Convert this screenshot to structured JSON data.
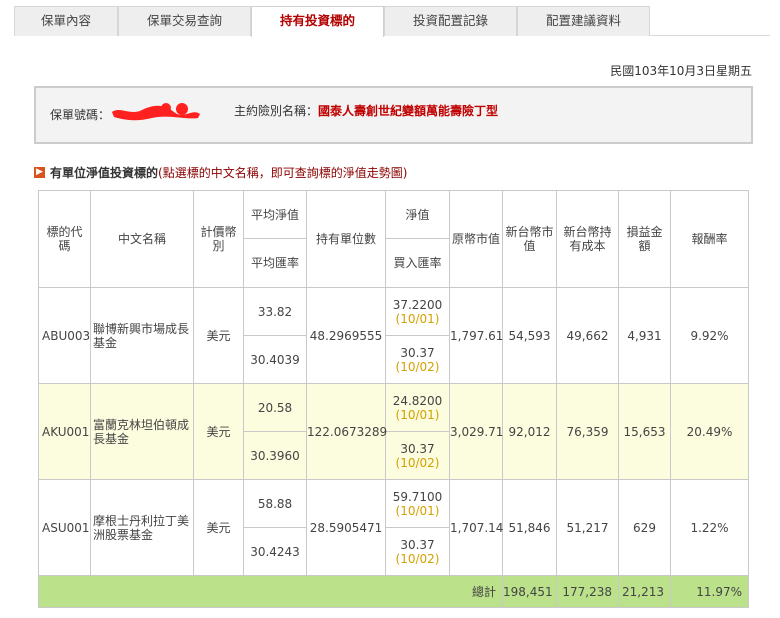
{
  "tabs": [
    {
      "label": "保單內容",
      "active": false
    },
    {
      "label": "保單交易查詢",
      "active": false
    },
    {
      "label": "持有投資標的",
      "active": true
    },
    {
      "label": "投資配置記錄",
      "active": false
    },
    {
      "label": "配置建議資料",
      "active": false
    }
  ],
  "date": "民國103年10月3日星期五",
  "policy": {
    "number_label": "保單號碼：",
    "contract_label": "主約險別名稱：",
    "contract_name": "國泰人壽創世紀變額萬能壽險丁型"
  },
  "section": {
    "title_bold": "有單位淨值投資標的",
    "title_hint": "(點選標的中文名稱，即可查詢標的淨值走勢圖)"
  },
  "table": {
    "headers": {
      "code": "標的代碼",
      "name": "中文名稱",
      "currency": "計價幣別",
      "avg_nav": "平均淨值",
      "avg_fx": "平均匯率",
      "units": "持有單位數",
      "nav": "淨值",
      "buy_fx": "買入匯率",
      "orig_value": "原幣市值",
      "twd_value": "新台幣市值",
      "twd_cost": "新台幣持有成本",
      "pl": "損益金額",
      "roi": "報酬率"
    },
    "rows": [
      {
        "code": "ABU003",
        "name": "聯博新興市場成長基金",
        "currency": "美元",
        "avg_nav": "33.82",
        "avg_fx": "30.4039",
        "units": "48.2969555",
        "nav": "37.2200",
        "nav_date": "(10/01)",
        "buy_fx": "30.37",
        "fx_date": "(10/02)",
        "orig_value": "1,797.61",
        "twd_value": "54,593",
        "twd_cost": "49,662",
        "pl": "4,931",
        "roi": "9.92%"
      },
      {
        "code": "AKU001",
        "name": "富蘭克林坦伯頓成長基金",
        "currency": "美元",
        "avg_nav": "20.58",
        "avg_fx": "30.3960",
        "units": "122.0673289",
        "nav": "24.8200",
        "nav_date": "(10/01)",
        "buy_fx": "30.37",
        "fx_date": "(10/02)",
        "orig_value": "3,029.71",
        "twd_value": "92,012",
        "twd_cost": "76,359",
        "pl": "15,653",
        "roi": "20.49%"
      },
      {
        "code": "ASU001",
        "name": "摩根士丹利拉丁美洲股票基金",
        "currency": "美元",
        "avg_nav": "58.88",
        "avg_fx": "30.4243",
        "units": "28.5905471",
        "nav": "59.7100",
        "nav_date": "(10/01)",
        "buy_fx": "30.37",
        "fx_date": "(10/02)",
        "orig_value": "1,707.14",
        "twd_value": "51,846",
        "twd_cost": "51,217",
        "pl": "629",
        "roi": "1.22%"
      }
    ],
    "total": {
      "label": "總計",
      "twd_value": "198,451",
      "twd_cost": "177,238",
      "pl": "21,213",
      "roi": "11.97%"
    }
  },
  "colors": {
    "accent_red": "#b30000",
    "fund_link": "#8b0000",
    "date_gold": "#d4a000",
    "highlight_row": "#fcfcdf",
    "total_green": "#bbe18b"
  }
}
